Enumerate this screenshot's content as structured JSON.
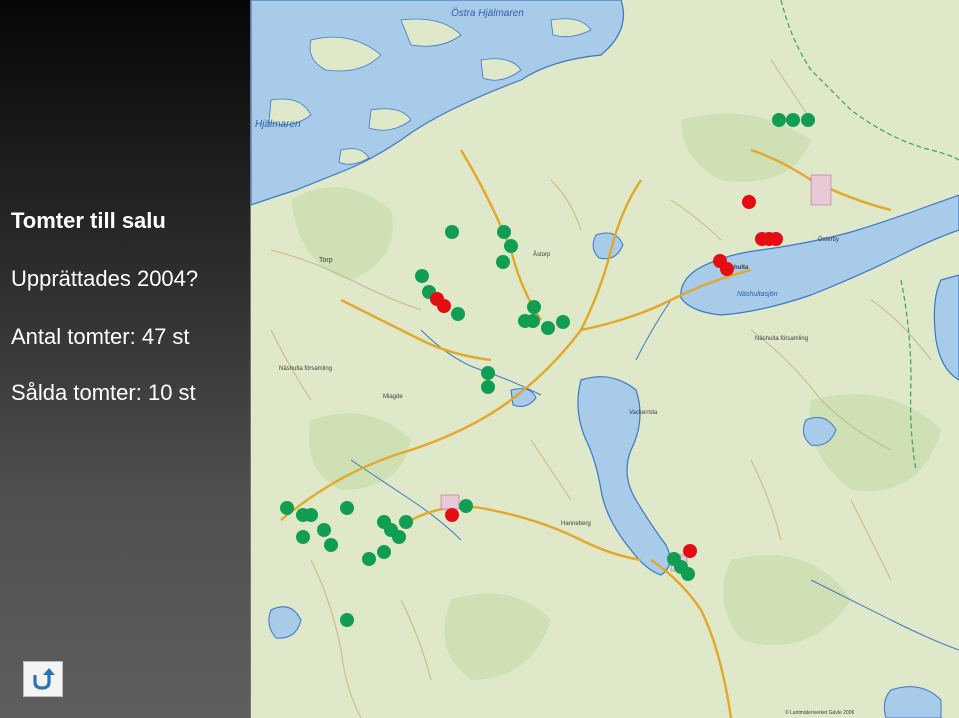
{
  "panel": {
    "title": "Tomter till salu",
    "line1": "Upprättades 2004?",
    "line2": "Antal tomter: 47 st",
    "line3": "Sålda tomter: 10 st"
  },
  "map": {
    "labels": {
      "ostra_hjalmaren": "Östra Hjälmaren",
      "hjalmaren": "Hjälmaren",
      "nashulta": "Näshulta",
      "nashultasjon": "Näshultasjön",
      "nashulta_forsamling_east": "Näshulta församling",
      "nashulta_forsamling_west": "Näshulta församling",
      "torp": "Torp",
      "astorp": "Åstorp",
      "osterby": "Österby",
      "vackerrida": "Vackerrida",
      "hanneberg": "Hanneberg",
      "miagde": "Miagde",
      "credit": "© Lantmäteriverket Gävle 2006"
    },
    "colors": {
      "land": "#dfe9c9",
      "water": "#a7cbe9",
      "water_edge": "#3a78c2",
      "forsale": "#129d55",
      "sold": "#e40d12"
    }
  },
  "icons": {
    "back": "return-arrow-icon"
  }
}
